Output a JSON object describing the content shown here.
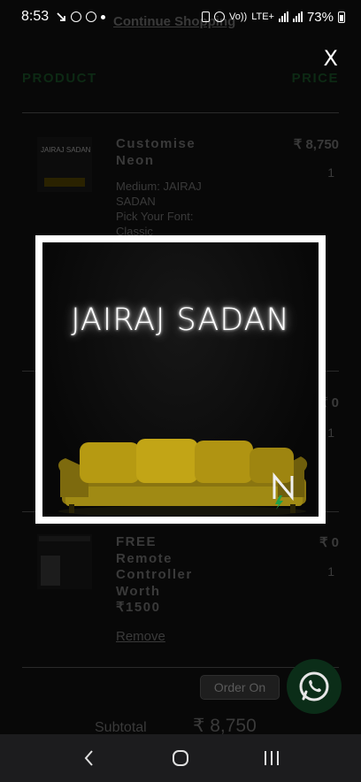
{
  "status_bar": {
    "time": "8:53",
    "network": "Vo))",
    "network_type": "LTE+",
    "network_sub": "LTE1",
    "battery_percent": "73%"
  },
  "page": {
    "continue_link": "Continue Shopping",
    "columns": {
      "product": "PRODUCT",
      "price": "PRICE"
    },
    "items": [
      {
        "name_lines": [
          "Customise",
          "Neon"
        ],
        "meta_lines": [
          "Medium: JAIRAJ",
          "SADAN",
          "Pick Your Font:",
          "Classic"
        ],
        "price": "₹ 8,750",
        "qty": "1",
        "thumb_text": "JAIRAJ SADAN"
      },
      {
        "price": "₹ 0",
        "qty": "1"
      },
      {
        "name_lines": [
          "FREE",
          "Remote",
          "Controller",
          "Worth",
          "₹1500"
        ],
        "price": "₹ 0",
        "qty": "1",
        "remove_label": "Remove"
      }
    ],
    "order_button": "Order On",
    "subtotal_label": "Subtotal",
    "subtotal_value": "₹ 8,750"
  },
  "modal": {
    "close_label": "X",
    "neon_text": "JAIRAJ SADAN",
    "logo_letter": "N"
  },
  "colors": {
    "accent_green": "#1fa04a",
    "whatsapp_green": "#25d366",
    "neon_white": "#ffffff",
    "sofa_mustard": "#b69a12"
  },
  "icons": {
    "nav_back": "chevron-left-icon",
    "nav_home": "home-circle-icon",
    "nav_recents": "recents-icon",
    "whatsapp": "whatsapp-icon"
  }
}
